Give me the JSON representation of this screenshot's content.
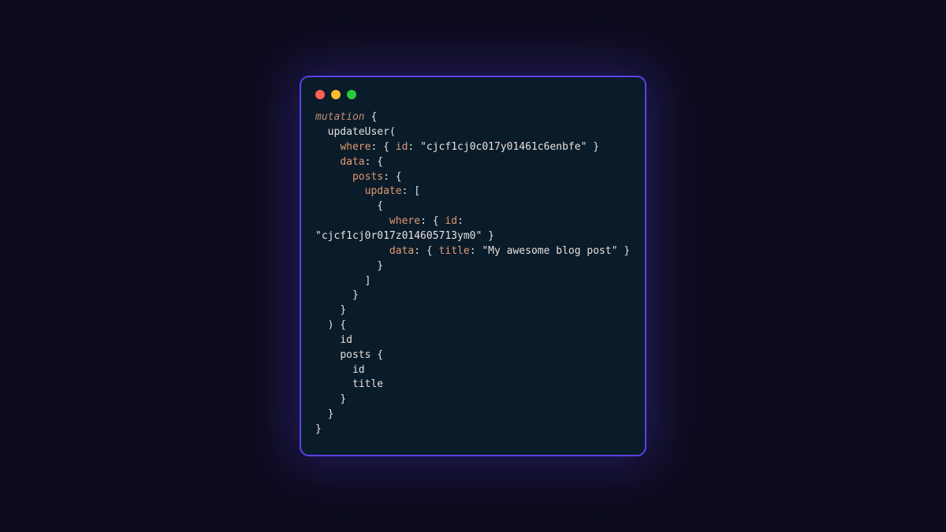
{
  "window": {
    "traffic": {
      "red": "#ff5f56",
      "yellow": "#ffbd2e",
      "green": "#27c93f"
    }
  },
  "code": {
    "keyword_mutation": "mutation",
    "fn_updateUser": "updateUser",
    "key_where": "where",
    "key_id": "id",
    "val_userId": "\"cjcf1cj0c017y01461c6enbfe\"",
    "key_data": "data",
    "key_posts": "posts",
    "key_update": "update",
    "val_postId": "\"cjcf1cj0r017z014605713ym0\"",
    "key_title": "title",
    "val_title": "\"My awesome blog post\"",
    "sel_id": "id",
    "sel_posts": "posts",
    "sel_posts_id": "id",
    "sel_posts_title": "title"
  }
}
